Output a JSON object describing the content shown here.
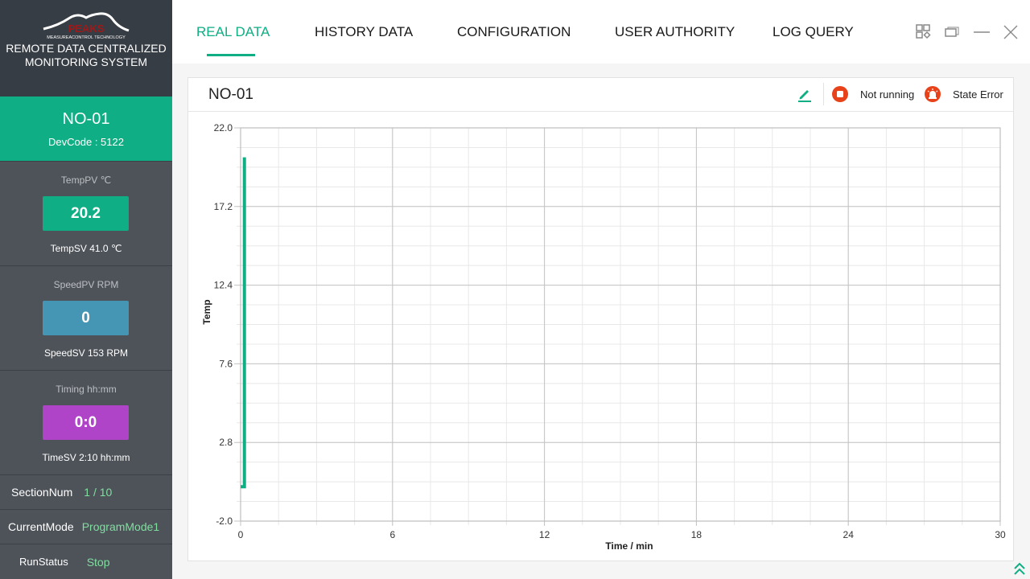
{
  "sidebar": {
    "logo": {
      "brand": "PEAKS",
      "tagline": "MEASUREACONTROL TECHNOLOGY"
    },
    "system_title_line1": "REMOTE DATA CENTRALIZED",
    "system_title_line2": "MONITORING SYSTEM",
    "device": {
      "name": "NO-01",
      "devcode": "DevCode : 5122"
    },
    "metrics": [
      {
        "label": "TempPV ℃",
        "value": "20.2",
        "sv": "TempSV 41.0 ℃",
        "color": "#10ae84"
      },
      {
        "label": "SpeedPV RPM",
        "value": "0",
        "sv": "SpeedSV 153 RPM",
        "color": "#4596b4"
      },
      {
        "label": "Timing hh:mm",
        "value": "0:0",
        "sv": "TimeSV 2:10 hh:mm",
        "color": "#b044c9"
      }
    ],
    "info": [
      {
        "label": "SectionNum",
        "value": "1 / 10"
      },
      {
        "label": "CurrentMode",
        "value": "ProgramMode1"
      },
      {
        "label": "RunStatus",
        "value": "Stop"
      }
    ]
  },
  "tabs": [
    {
      "label": "REAL DATA",
      "active": true
    },
    {
      "label": "HISTORY DATA",
      "active": false
    },
    {
      "label": "CONFIGURATION",
      "active": false
    },
    {
      "label": "USER AUTHORITY",
      "active": false
    },
    {
      "label": "LOG QUERY",
      "active": false
    }
  ],
  "window_controls": [
    "layout-icon",
    "restore-icon",
    "minimize-icon",
    "close-icon"
  ],
  "panel": {
    "title": "NO-01",
    "edit_icon": "pencil-icon",
    "run_state": {
      "icon": "stop-icon",
      "label": "Not running",
      "color": "#e8421a"
    },
    "alarm_state": {
      "icon": "alarm-icon",
      "label": "State Error",
      "color": "#e8421a"
    }
  },
  "accent_color": "#10ae84",
  "chart_data": {
    "type": "line",
    "title": "",
    "xlabel": "Time / min",
    "ylabel": "Temp",
    "xlim": [
      0,
      30
    ],
    "ylim": [
      -2.0,
      22.0
    ],
    "x_ticks": [
      "0",
      "6",
      "12",
      "18",
      "24",
      "30"
    ],
    "y_ticks": [
      "-2.0",
      "2.8",
      "7.6",
      "12.4",
      "17.2",
      "22.0"
    ],
    "grid": true,
    "series": [
      {
        "name": "Temp",
        "color": "#10ae84",
        "x": [
          0.0,
          0.15,
          0.15
        ],
        "y": [
          0.1,
          0.1,
          20.2
        ]
      }
    ]
  }
}
